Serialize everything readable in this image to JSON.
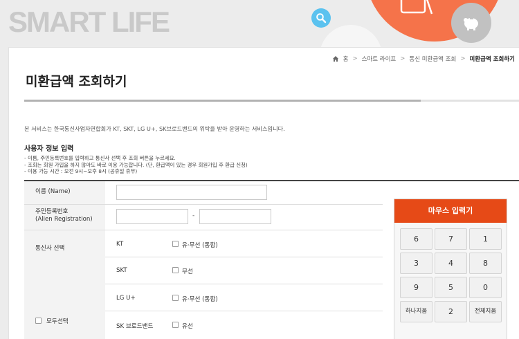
{
  "banner": {
    "brand": "SMART LIFE"
  },
  "breadcrumb": [
    "홈",
    "스마트 라이프",
    "통신 미환급액 조회",
    "미환급액 조회하기"
  ],
  "page_title": "미환급액 조회하기",
  "progress": {
    "fraction": 0.8
  },
  "intro": "본 서비스는 한국통신사업자연합회가 KT, SKT, LG U+, SK브로드밴드의 위탁을 받아 운영하는 서비스입니다.",
  "section_title": "사용자 정보 입력",
  "notes": [
    "- 이름, 주민등록번호를 입력하고 통신사 선택 후 조회 버튼을 누르세요.",
    "- 조회는 회원 가입을 하지 않아도 바로 이용 가능합니다. (단, 환급액이 있는 경우 회원가입 후 환급 신청)",
    "- 이용 가능 시간 : 오전 9시~오후 8시 (공휴일 휴무)"
  ],
  "form": {
    "name_label": "이름 (Name)",
    "name_value": "",
    "rrn_label_line1": "주민등록번호",
    "rrn_label_line2": "(Alien Registration)",
    "rrn_front_value": "",
    "rrn_back_value": "",
    "dash": "-",
    "carrier_label": "통신사 선택",
    "select_all_label": "모두선택",
    "carriers": [
      {
        "name": "KT",
        "option": "유·무선 (통합)"
      },
      {
        "name": "SKT",
        "option": "무선"
      },
      {
        "name": "LG U+",
        "option": "유·무선 (통합)"
      },
      {
        "name": "SK 브로드밴드",
        "option": "유선"
      }
    ]
  },
  "keypad": {
    "title": "마우스 입력기",
    "keys": [
      "6",
      "7",
      "1",
      "3",
      "4",
      "8",
      "9",
      "5",
      "0",
      "하나지움",
      "2",
      "전체지움"
    ]
  }
}
